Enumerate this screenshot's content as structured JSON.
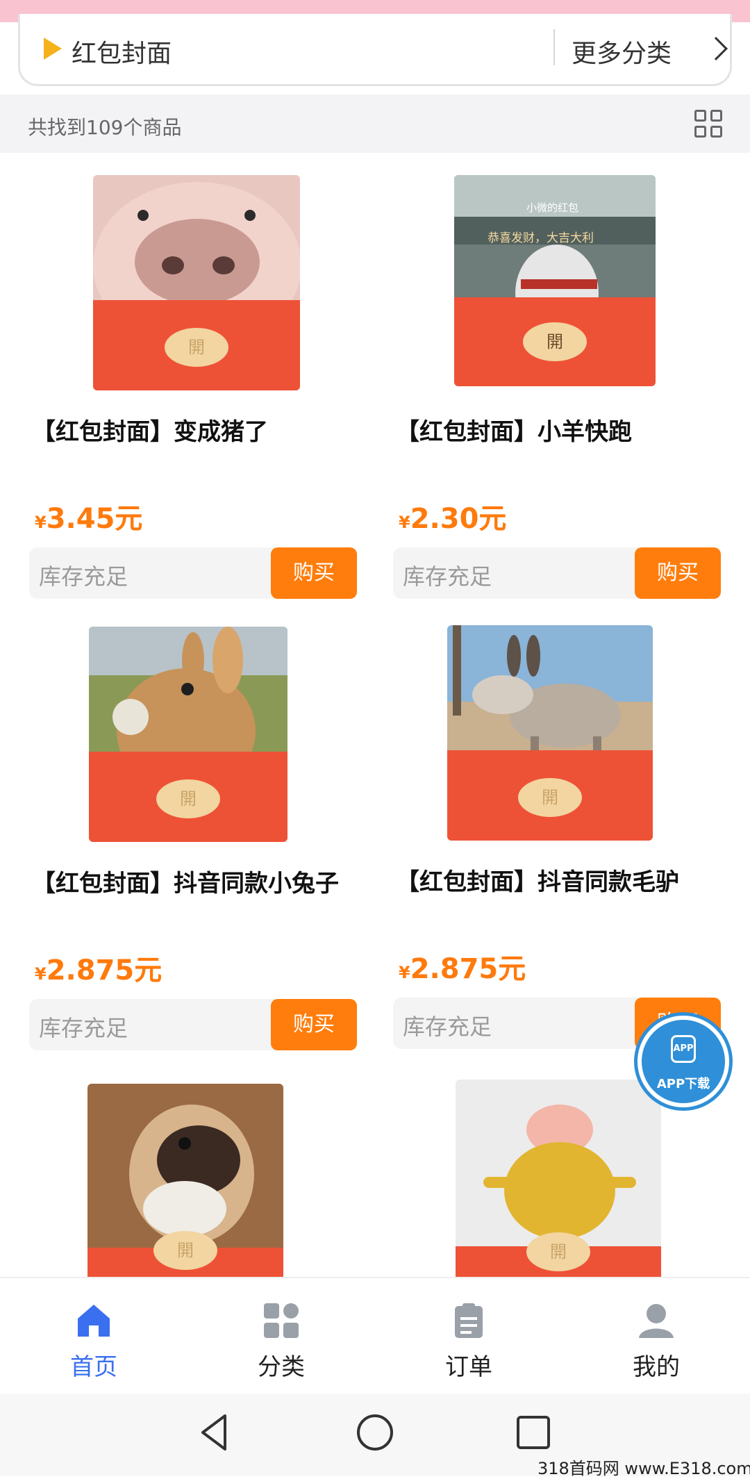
{
  "category": {
    "title": "红包封面",
    "more_label": "更多分类"
  },
  "results": {
    "count_text": "共找到109个商品"
  },
  "products": [
    {
      "title": "【红包封面】变成猪了",
      "price": "3.45元",
      "currency": "¥",
      "stock": "库存充足",
      "buy": "购买",
      "seal": "開",
      "photo": "pig-photo",
      "colors": [
        "#e9c7c1",
        "#c99a92",
        "#8c7a6a"
      ]
    },
    {
      "title": "【红包封面】小羊快跑",
      "price": "2.30元",
      "currency": "¥",
      "stock": "库存充足",
      "buy": "购买",
      "seal": "開",
      "photo": "goat-photo",
      "overlay": [
        "小微的红包",
        "恭喜发财，大吉大利"
      ],
      "colors": [
        "#6e7c7a",
        "#aab0ad",
        "#3a3f3e"
      ]
    },
    {
      "title": "【红包封面】抖音同款小兔子",
      "price": "2.875元",
      "currency": "¥",
      "stock": "库存充足",
      "buy": "购买",
      "seal": "開",
      "photo": "rabbit-photo",
      "colors": [
        "#c7935a",
        "#e6c08b",
        "#6d7f3b"
      ]
    },
    {
      "title": "【红包封面】抖音同款毛驴",
      "price": "2.875元",
      "currency": "¥",
      "stock": "库存充足",
      "buy": "购买",
      "seal": "開",
      "photo": "donkey-photo",
      "colors": [
        "#8ab4d8",
        "#c9b08f",
        "#7a6a58"
      ]
    },
    {
      "title": "",
      "price": "",
      "currency": "",
      "stock": "",
      "buy": "",
      "seal": "開",
      "photo": "pug-photo",
      "colors": [
        "#9a6a44",
        "#d8b48c",
        "#3b2a22"
      ]
    },
    {
      "title": "",
      "price": "",
      "currency": "",
      "stock": "",
      "buy": "",
      "seal": "開",
      "photo": "gold-pig-photo",
      "colors": [
        "#ececec",
        "#f3b6a8",
        "#e2b531"
      ]
    }
  ],
  "fab": {
    "icon_text": "APP",
    "label": "APP下载"
  },
  "tabs": [
    {
      "label": "首页",
      "icon": "home-icon",
      "active": true
    },
    {
      "label": "分类",
      "icon": "category-icon",
      "active": false
    },
    {
      "label": "订单",
      "icon": "order-icon",
      "active": false
    },
    {
      "label": "我的",
      "icon": "profile-icon",
      "active": false
    }
  ],
  "colors": {
    "accent": "#ff7d0c",
    "active_tab": "#3a6ff0",
    "envelope_red": "#ee5236"
  },
  "watermark": "318首码网 www.E318.com"
}
